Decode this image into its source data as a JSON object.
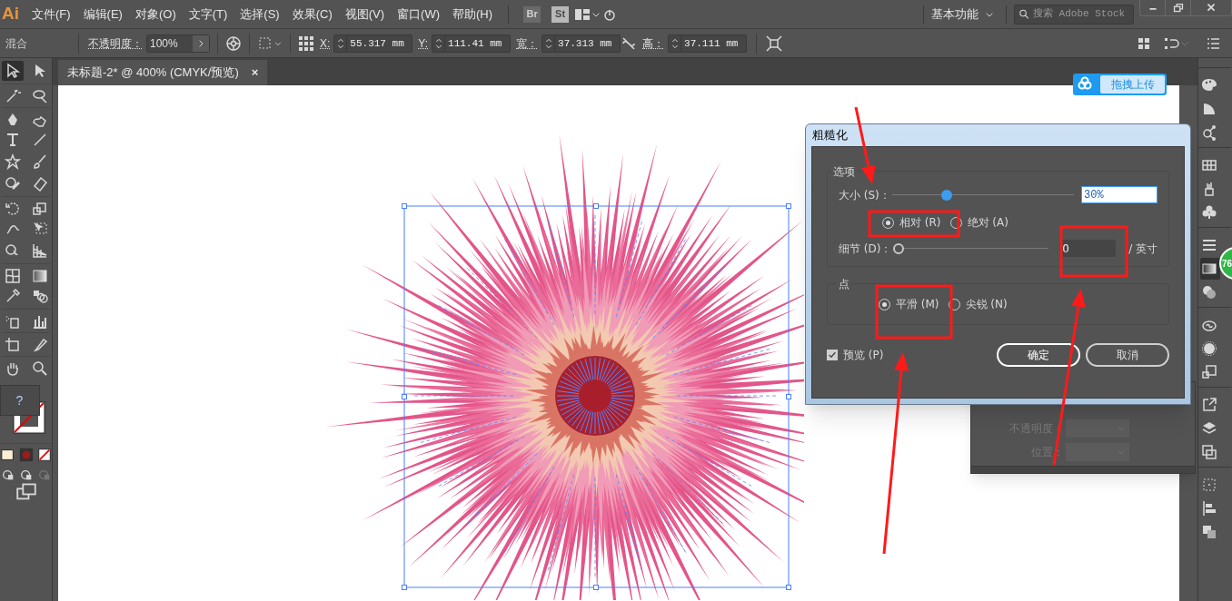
{
  "app": {
    "logo": "Ai",
    "menus": [
      "文件(F)",
      "编辑(E)",
      "对象(O)",
      "文字(T)",
      "选择(S)",
      "效果(C)",
      "视图(V)",
      "窗口(W)",
      "帮助(H)"
    ],
    "bridge_buttons": [
      "Br",
      "St"
    ],
    "workspace": "基本功能",
    "search": {
      "placeholder": "搜索 Adobe Stock"
    }
  },
  "control_bar": {
    "mode": "混合",
    "opacity_label": "不透明度：",
    "opacity_value": "100%",
    "fields": [
      {
        "label": "X:",
        "value": "55.317 mm"
      },
      {
        "label": "Y:",
        "value": "111.41 mm"
      },
      {
        "label": "宽：",
        "value": "37.313 mm"
      },
      {
        "label": "高：",
        "value": "37.111 mm"
      }
    ]
  },
  "document_tab": {
    "title": "未标题-2* @ 400% (CMYK/预览)",
    "close": "×"
  },
  "toolbar": {
    "help": "?"
  },
  "upload_button": "拖拽上传",
  "badge": "76",
  "properties_panel": {
    "rows": [
      "不透明度：",
      "位置："
    ]
  },
  "dialog": {
    "title": "粗糙化",
    "options_group": "选项",
    "size": {
      "label": "大小 (S)：",
      "level": 0.29,
      "value": "30%"
    },
    "modes": [
      {
        "label": "相对 (R)",
        "selected": true
      },
      {
        "label": "绝对 (A)",
        "selected": false
      }
    ],
    "detail": {
      "label": "细节 (D)：",
      "level": 0,
      "value": "0",
      "unit": "/ 英寸"
    },
    "points_group": "点",
    "points": [
      {
        "label": "平滑 (M)",
        "selected": true
      },
      {
        "label": "尖锐 (N)",
        "selected": false
      }
    ],
    "preview": {
      "label": "预览 (P)",
      "checked": true
    },
    "buttons": [
      "确定",
      "取消"
    ]
  }
}
